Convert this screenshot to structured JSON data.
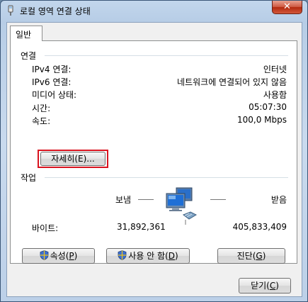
{
  "window": {
    "title": "로컬 영역 연결 상태"
  },
  "tabs": [
    {
      "label": "일반"
    }
  ],
  "connection": {
    "section_title": "연결",
    "rows": [
      {
        "label": "IPv4 연결:",
        "value": "인터넷"
      },
      {
        "label": "IPv6 연결:",
        "value": "네트워크에 연결되어 있지 않음"
      },
      {
        "label": "미디어 상태:",
        "value": "사용함"
      },
      {
        "label": "시간:",
        "value": "05:07:30"
      },
      {
        "label": "속도:",
        "value": "100,0 Mbps"
      }
    ],
    "details_button": "자세히(E)..."
  },
  "activity": {
    "section_title": "작업",
    "sent_label": "보냄",
    "received_label": "받음",
    "bytes_label": "바이트:",
    "bytes_sent": "31,892,361",
    "bytes_received": "405,833,409"
  },
  "buttons": {
    "properties": {
      "text": "속성(",
      "key": "P",
      "end": ")"
    },
    "disable": {
      "text": "사용 안 함(",
      "key": "D",
      "end": ")"
    },
    "diagnose": {
      "text": "진단(",
      "key": "G",
      "end": ")"
    },
    "close": {
      "text": "닫기(",
      "key": "C",
      "end": ")"
    }
  },
  "icons": {
    "title": "network-adapter-icon",
    "close": "close-icon",
    "network": "network-computers-icon",
    "shield": "uac-shield-icon"
  },
  "colors": {
    "highlight_border": "#d9131f",
    "close_button": "#c7452a"
  }
}
